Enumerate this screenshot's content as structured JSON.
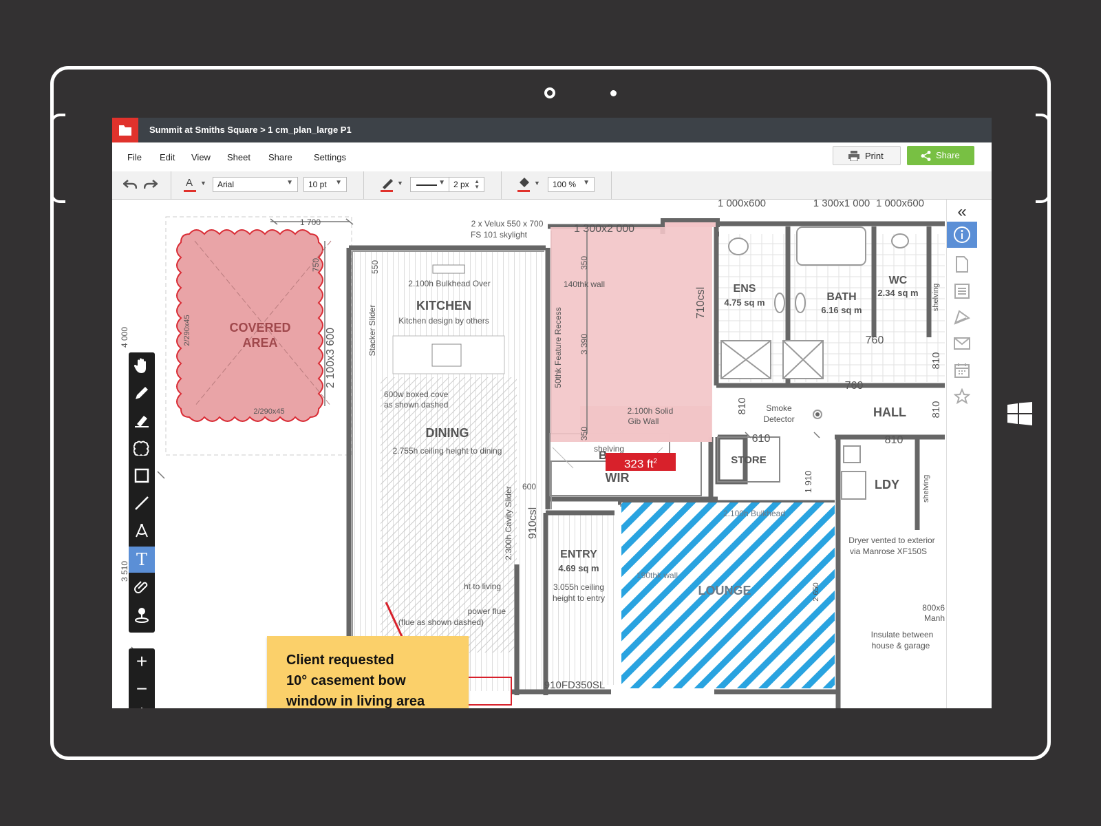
{
  "window": {
    "breadcrumb": "Summit at Smiths Square > 1 cm_plan_large P1"
  },
  "menu": {
    "items": [
      "File",
      "Edit",
      "View",
      "Sheet",
      "Share",
      "Settings"
    ],
    "print_label": "Print",
    "share_label": "Share"
  },
  "toolbar": {
    "font_family": "Arial",
    "font_size": "10 pt",
    "line_width": "2 px",
    "opacity": "100 %"
  },
  "tools": [
    "pan-tool",
    "pen-tool",
    "highlighter-tool",
    "cloud-tool",
    "rectangle-tool",
    "line-tool",
    "measure-tool",
    "text-tool",
    "attachment-tool",
    "stamp-tool"
  ],
  "active_tool": "text-tool",
  "rightbar_icons": [
    "collapse-icon",
    "info-icon",
    "document-icon",
    "list-icon",
    "palette-icon",
    "mail-icon",
    "calendar-icon",
    "star-icon"
  ],
  "annotations": {
    "note_lines": [
      "Client requested",
      "10° casement bow",
      "window in living area"
    ],
    "area_value": "323 ft",
    "area_unit_sup": "2"
  },
  "plan": {
    "labels": {
      "covered_area_1": "COVERED",
      "covered_area_2": "AREA",
      "kitchen": "KITCHEN",
      "kitchen_note": "Kitchen design by others",
      "bulkhead": "2.100h Bulkhead Over",
      "dining": "DINING",
      "dining_note": "2.755h ceiling height to dining",
      "boxed_cove_1": "600w boxed cove",
      "boxed_cove_2": "as shown dashed",
      "ens": "ENS",
      "ens_area": "4.75 sq m",
      "bath": "BATH",
      "bath_area": "6.16 sq m",
      "wc": "WC",
      "wc_area": "2.34 sq m",
      "hall": "HALL",
      "store": "STORE",
      "ldy": "LDY",
      "wir": "WIR",
      "entry": "ENTRY",
      "entry_area": "4.69 sq m",
      "entry_note_1": "3.055h ceiling",
      "entry_note_2": "height to entry",
      "lounge": "LOUNGE",
      "lounge_bulkhead": "2.100h Bulkhead",
      "lounge_wall": "190thk wall",
      "smoke_1": "Smoke",
      "smoke_2": "Detector",
      "shelving": "shelving",
      "skylight_1": "2 x Velux 550 x 700",
      "skylight_2": "FS 101 skylight",
      "wall_140": "140thk wall",
      "feature_recess": "50thk Feature Recess",
      "solid_wall_1": "2.100h Solid",
      "solid_wall_2": "Gib Wall",
      "stacker": "Stacker Slider",
      "cavity": "2.300h Cavity Slider",
      "dryer_1": "Dryer vented to exterior",
      "dryer_2": "via Manrose XF150S",
      "insulate_1": "Insulate between",
      "insulate_2": "house & garage",
      "door_unit": "910FD350SL",
      "flue_1": "power flue",
      "flue_2": "(flue as shown dashed)",
      "living_frag": "ht to living",
      "manhole_1": "800x6",
      "manhole_2": "Manh",
      "bed_letter": "B"
    },
    "dimensions": {
      "d1700": "1 700",
      "d1300x2000": "1 300x2 000",
      "d1000x600a": "1 000x600",
      "d1300x1000": "1 300x1 000",
      "d1000x600b": "1 000x600",
      "d750": "750",
      "d550": "550",
      "d350a": "350",
      "d350b": "350",
      "d3390": "3 390",
      "d710csl": "710csl",
      "d910csl": "910csl",
      "d2100x3600": "2 100x3 600",
      "d2_290x45a": "2/290x45",
      "d2_290x45b": "2/290x45",
      "d760a": "760",
      "d760b": "760",
      "d810a": "810",
      "d810b": "810",
      "d810c": "810",
      "d810d": "810",
      "d610": "610",
      "d1910": "1 910",
      "d600": "600",
      "d2650": "2 650",
      "d4000": "4 000",
      "d3510": "3 510"
    }
  },
  "colors": {
    "title_bar": "#3d4248",
    "accent_red": "#e0322c",
    "share_green": "#78c043",
    "cloud_fill": "#e8a0a3",
    "room_highlight": "#f2c4c7",
    "hatch_blue": "#29a3e0",
    "note_yellow": "#fbd06a",
    "active_tool": "#5b8fd6"
  }
}
